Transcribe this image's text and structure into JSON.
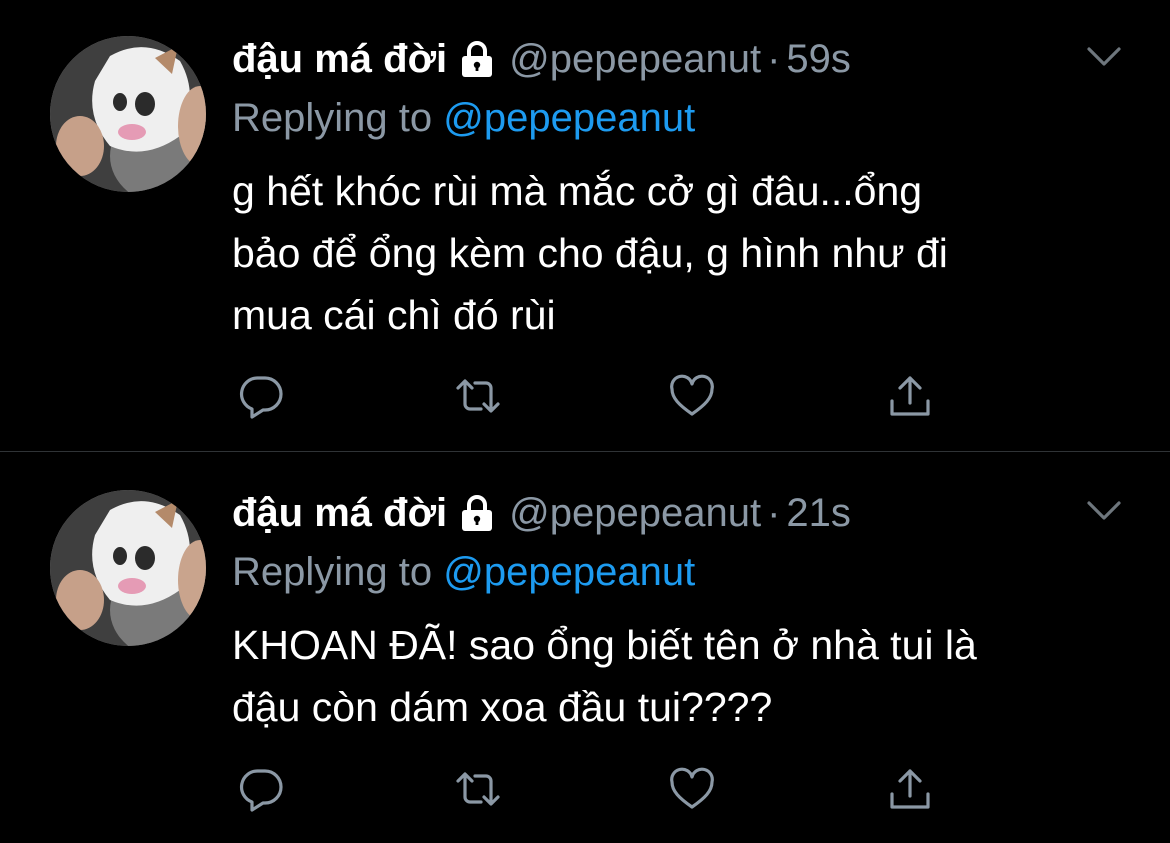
{
  "colors": {
    "background": "#000000",
    "text": "#ffffff",
    "secondary_text": "#8b98a5",
    "link": "#1d9bf0",
    "divider": "#2f3336"
  },
  "tweets": [
    {
      "display_name": "đậu má đời",
      "handle": "@pepepeanut",
      "separator": "·",
      "time": "59s",
      "replying_prefix": "Replying to",
      "replying_to": "@pepepeanut",
      "text_lines": [
        "g hết khóc rùi mà mắc cở gì đâu...ổng",
        "bảo để ổng kèm cho đậu, g hình như đi",
        "mua cái chì đó rùi"
      ],
      "icons": [
        "lock-icon",
        "chevron-down-icon",
        "reply-icon",
        "retweet-icon",
        "like-icon",
        "share-icon"
      ]
    },
    {
      "display_name": "đậu má đời",
      "handle": "@pepepeanut",
      "separator": "·",
      "time": "21s",
      "replying_prefix": "Replying to",
      "replying_to": "@pepepeanut",
      "text_lines": [
        "KHOAN ĐÃ! sao ổng biết tên ở nhà tui là",
        "đậu còn dám xoa đầu tui????"
      ],
      "icons": [
        "lock-icon",
        "chevron-down-icon",
        "reply-icon",
        "retweet-icon",
        "like-icon",
        "share-icon"
      ]
    }
  ]
}
